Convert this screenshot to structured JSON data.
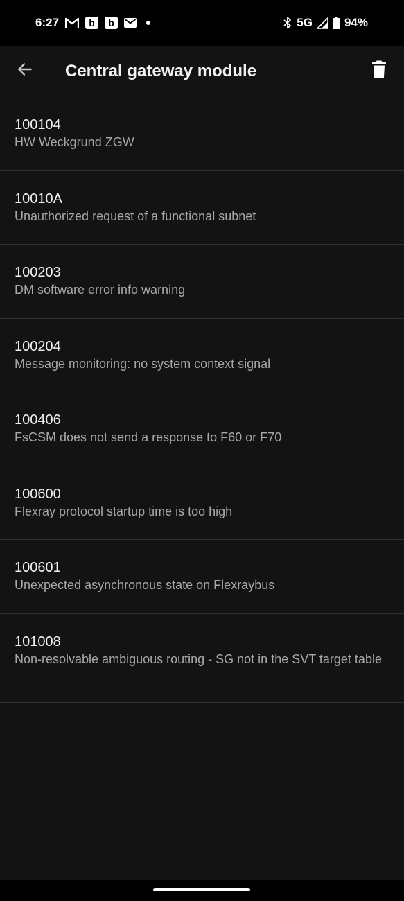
{
  "status_bar": {
    "time": "6:27",
    "notification_icons": [
      "gmail-icon",
      "b-app-icon",
      "b-app-icon",
      "mail-icon",
      "dot-icon"
    ],
    "b_icon_label": "b",
    "network": "5G",
    "battery": "94%",
    "system_icons": [
      "bluetooth-icon",
      "signal-icon",
      "battery-icon"
    ]
  },
  "app_bar": {
    "title": "Central gateway module",
    "back_icon": "arrow-left-icon",
    "delete_icon": "trash-icon"
  },
  "fault_codes": [
    {
      "code": "100104",
      "description": "HW Weckgrund ZGW"
    },
    {
      "code": "10010A",
      "description": "Unauthorized request of a functional subnet"
    },
    {
      "code": "100203",
      "description": "DM software error info warning"
    },
    {
      "code": "100204",
      "description": "Message monitoring: no system context signal"
    },
    {
      "code": "100406",
      "description": "FsCSM does not send a response to F60 or F70"
    },
    {
      "code": "100600",
      "description": "Flexray protocol startup time is too high"
    },
    {
      "code": "100601",
      "description": "Unexpected asynchronous state on Flexraybus"
    },
    {
      "code": "101008",
      "description": "Non-resolvable ambiguous routing - SG not in the SVT target table"
    }
  ],
  "colors": {
    "background": "#131313",
    "status_bar": "#000000",
    "primary_text": "#f0f0f0",
    "secondary_text": "#a8a8a8",
    "divider": "#2e2e2e"
  }
}
